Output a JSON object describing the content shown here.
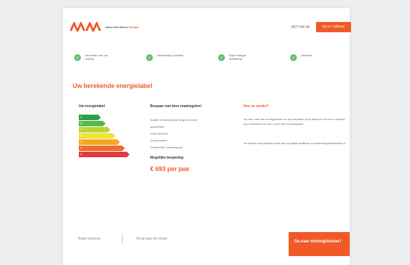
{
  "brand": {
    "name_prefix": "Woon Wel Wilcke",
    "name_accent": "Energie"
  },
  "header": {
    "phone": "0577 KR 24",
    "login_label": "log in / afbouw"
  },
  "steps": [
    {
      "label": "Informatie over uw woning"
    },
    {
      "label": "Verwarming & isolatie"
    },
    {
      "label": "Eigen energie opwekking"
    },
    {
      "label": "Afronden"
    }
  ],
  "page_title": "Uw berekende energielabel",
  "energy_label": {
    "heading": "Uw energielabel",
    "bars": [
      {
        "letter": "A",
        "color": "#2e9e4a",
        "level": 0.28
      },
      {
        "letter": "B",
        "color": "#57b947",
        "level": 0.35
      },
      {
        "letter": "C",
        "color": "#b9d638",
        "level": 0.42
      },
      {
        "letter": "D",
        "color": "#f1e330",
        "level": 0.49
      },
      {
        "letter": "E",
        "color": "#f5a623",
        "level": 0.56
      },
      {
        "letter": "F",
        "color": "#ef6c2c",
        "level": 0.63
      },
      {
        "letter": "G",
        "color": "#e13a3f",
        "level": 0.7
      }
    ]
  },
  "measures": {
    "heading": "Bespaar met deze maatregelen!",
    "items": [
      "Isolatie of extra isolatie bij gevels en/of",
      "spouwmuur",
      "Extra HR-ketel",
      "Zonnepanelen",
      "Zonneboiler / warmtepomp"
    ],
    "saving_label": "Mogelijke besparing:",
    "saving_value": "€ 693 per jaar"
  },
  "next_steps": {
    "heading": "Hoe nu verder?",
    "paragraph1": "Ga door naar het woningdossier om uw resultaten op te slaan en zie hoe u uw label kunt verbeteren en hoe u tot € 693 kunt besparen.",
    "paragraph2": "Uw nieuwe energielabel wordt dan ook gelijk zichtbaar op www.energielabelvinkel.nl"
  },
  "footer": {
    "restart_label": "Begin opnieuw",
    "back_label": "Terug naar de vorige",
    "cta_label": "Ga naar woningdossier!"
  },
  "colors": {
    "accent": "#f05a28",
    "check": "#6cc070"
  }
}
